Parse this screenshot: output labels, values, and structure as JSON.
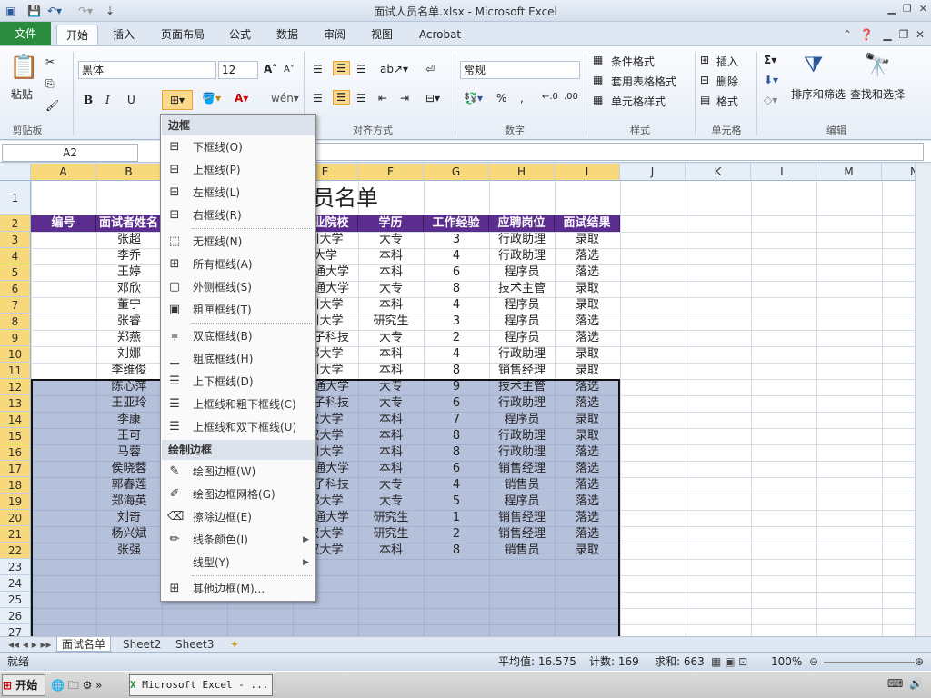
{
  "window": {
    "title": "面试人员名单.xlsx - Microsoft Excel"
  },
  "ribbon_tabs": [
    "文件",
    "开始",
    "插入",
    "页面布局",
    "公式",
    "数据",
    "审阅",
    "视图",
    "Acrobat"
  ],
  "ribbon": {
    "clipboard": {
      "paste": "粘贴",
      "label": "剪贴板"
    },
    "font": {
      "name": "黑体",
      "size": "12",
      "bold": "B",
      "italic": "I",
      "underline": "U"
    },
    "alignment": {
      "label": "对齐方式"
    },
    "number": {
      "format": "常规",
      "label": "数字",
      "percent": "%",
      "comma": ","
    },
    "styles": {
      "cond": "条件格式",
      "table": "套用表格格式",
      "cell": "单元格样式",
      "label": "样式"
    },
    "cells": {
      "insert": "插入",
      "delete": "删除",
      "format": "格式",
      "label": "单元格"
    },
    "editing": {
      "sort": "排序和筛选",
      "find": "查找和选择",
      "label": "编辑"
    }
  },
  "formula_bar": {
    "cell_ref": "A2",
    "fx": "fx"
  },
  "columns": [
    "A",
    "B",
    "C",
    "D",
    "E",
    "F",
    "G",
    "H",
    "I",
    "J",
    "K",
    "L",
    "M",
    "N"
  ],
  "rows": [
    "1",
    "2",
    "3",
    "4",
    "5",
    "6",
    "7",
    "8",
    "9",
    "10",
    "11",
    "12",
    "13",
    "14",
    "15",
    "16",
    "17",
    "18",
    "19",
    "20",
    "21",
    "22",
    "23",
    "24",
    "25",
    "26",
    "27"
  ],
  "sheet_title": "人员名单",
  "table": {
    "headers": [
      "编号",
      "面试者姓名",
      "毕业院校",
      "学历",
      "工作经验",
      "应聘岗位",
      "面试结果"
    ],
    "rows": [
      [
        "张超",
        "川大学",
        "大专",
        "3",
        "行政助理",
        "录取"
      ],
      [
        "李乔",
        "大学",
        "本科",
        "4",
        "行政助理",
        "落选"
      ],
      [
        "王婷",
        "交通大学",
        "本科",
        "6",
        "程序员",
        "落选"
      ],
      [
        "邓欣",
        "交通大学",
        "大专",
        "8",
        "技术主管",
        "录取"
      ],
      [
        "董宁",
        "川大学",
        "本科",
        "4",
        "程序员",
        "录取"
      ],
      [
        "张睿",
        "川大学",
        "研究生",
        "3",
        "程序员",
        "落选"
      ],
      [
        "郑燕",
        "电子科技",
        "大专",
        "2",
        "程序员",
        "落选"
      ],
      [
        "刘娜",
        "都大学",
        "本科",
        "4",
        "行政助理",
        "录取"
      ],
      [
        "李维俊",
        "川大学",
        "本科",
        "8",
        "销售经理",
        "录取"
      ],
      [
        "陈心萍",
        "交通大学",
        "大专",
        "9",
        "技术主管",
        "落选"
      ],
      [
        "王亚玲",
        "电子科技",
        "大专",
        "6",
        "行政助理",
        "落选"
      ],
      [
        "李康",
        "汉大学",
        "本科",
        "7",
        "程序员",
        "录取"
      ],
      [
        "王可",
        "汉大学",
        "本科",
        "8",
        "行政助理",
        "录取"
      ],
      [
        "马蓉",
        "川大学",
        "本科",
        "8",
        "行政助理",
        "落选"
      ],
      [
        "侯晓蓉",
        "交通大学",
        "本科",
        "6",
        "销售经理",
        "落选"
      ],
      [
        "郭春莲",
        "电子科技",
        "大专",
        "4",
        "销售员",
        "落选"
      ],
      [
        "郑海英",
        "都大学",
        "大专",
        "5",
        "程序员",
        "落选"
      ],
      [
        "刘奇",
        "交通大学",
        "研究生",
        "1",
        "销售经理",
        "落选"
      ],
      [
        "杨兴斌",
        "汉大学",
        "研究生",
        "2",
        "销售经理",
        "落选"
      ],
      [
        "张强",
        "汉大学",
        "本科",
        "8",
        "销售员",
        "录取"
      ]
    ]
  },
  "border_menu": {
    "header": "边框",
    "items": [
      "下框线(O)",
      "上框线(P)",
      "左框线(L)",
      "右框线(R)",
      "无框线(N)",
      "所有框线(A)",
      "外侧框线(S)",
      "粗匣框线(T)",
      "双底框线(B)",
      "粗底框线(H)",
      "上下框线(D)",
      "上框线和粗下框线(C)",
      "上框线和双下框线(U)"
    ],
    "draw_header": "绘制边框",
    "draw_items": [
      "绘图边框(W)",
      "绘图边框网格(G)",
      "擦除边框(E)",
      "线条颜色(I)",
      "线型(Y)"
    ],
    "more": "其他边框(M)..."
  },
  "sheet_tabs": [
    "面试名单",
    "Sheet2",
    "Sheet3"
  ],
  "status": {
    "ready": "就绪",
    "avg": "平均值: 16.575",
    "count": "计数: 169",
    "sum": "求和: 663",
    "zoom": "100%"
  },
  "taskbar": {
    "start": "开始",
    "app": "Microsoft Excel - ..."
  },
  "colors": {
    "header_fill": "#5b2d8e",
    "selection": "#788cbe",
    "file_tab": "#2a8a3e"
  }
}
